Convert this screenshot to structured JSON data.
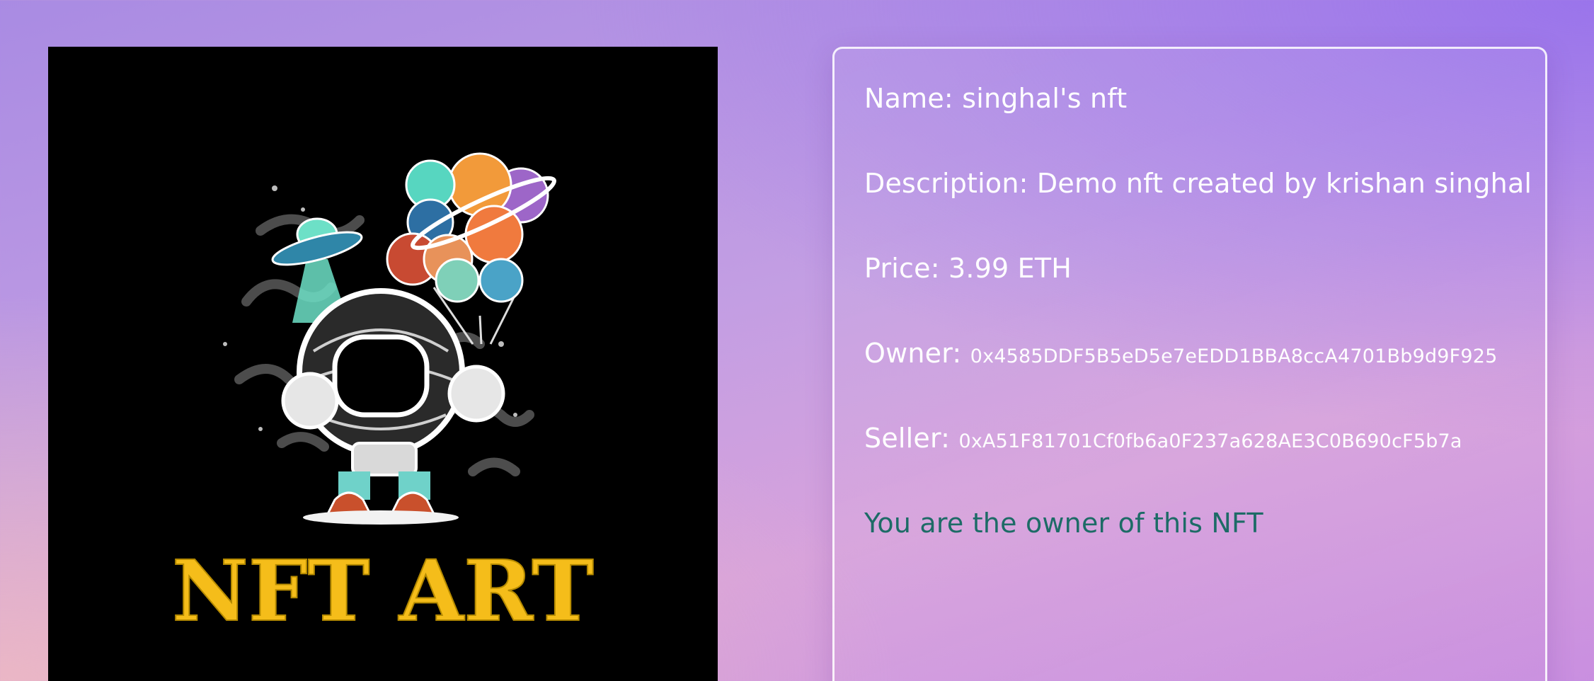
{
  "nft": {
    "image_alt": "NFT ART",
    "art_title": "NFT ART",
    "colors": {
      "title_yellow": "#f5bd1a",
      "background": "#000000"
    }
  },
  "details": {
    "name_label": "Name:",
    "name_value": "singhal's nft",
    "description_label": "Description:",
    "description_value": "Demo nft created by krishan singhal",
    "price_label": "Price:",
    "price_value": "3.99 ETH",
    "owner_label": "Owner:",
    "owner_value": "0x4585DDF5B5eD5e7eEDD1BBA8ccA4701Bb9d9F925",
    "seller_label": "Seller:",
    "seller_value": "0xA51F81701Cf0fb6a0F237a628AE3C0B690cF5b7a",
    "status_text": "You are the owner of this NFT",
    "status_color": "#1d6b66"
  }
}
